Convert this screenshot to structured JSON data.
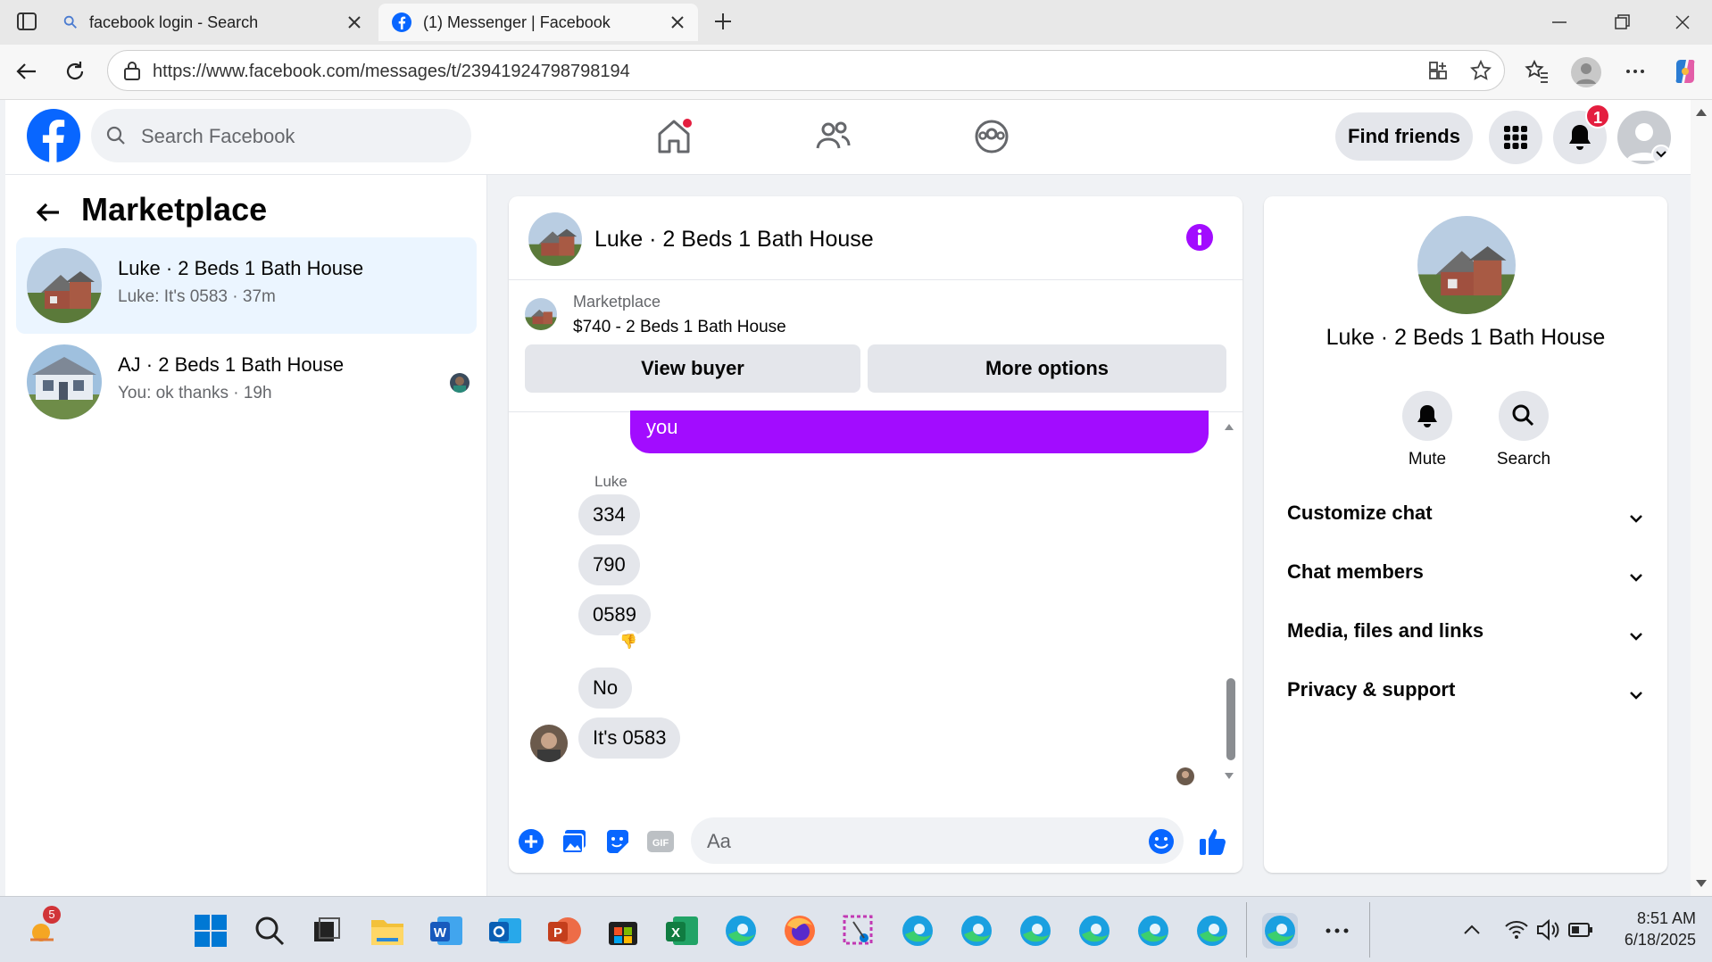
{
  "browser": {
    "tabs": [
      {
        "title": "facebook login - Search",
        "icon": "search-icon"
      },
      {
        "title": "(1) Messenger | Facebook",
        "icon": "facebook-icon"
      }
    ],
    "url": "https://www.facebook.com/messages/t/23941924798798194"
  },
  "header": {
    "search_placeholder": "Search Facebook",
    "find_friends": "Find friends",
    "notification_count": "1"
  },
  "sidebar": {
    "title": "Marketplace",
    "conversations": [
      {
        "name": "Luke · 2 Beds 1 Bath House",
        "preview": "Luke: It's 0583 · 37m",
        "active": true
      },
      {
        "name": "AJ · 2 Beds 1 Bath House",
        "preview": "You: ok thanks · 19h",
        "active": false
      }
    ]
  },
  "chat": {
    "title": "Luke · 2 Beds 1 Bath House",
    "marketplace_label": "Marketplace",
    "listing": "$740 - 2 Beds 1 Bath House",
    "view_buyer": "View buyer",
    "more_options": "More options",
    "outgoing_tail": "you",
    "sender": "Luke",
    "messages": [
      "334",
      "790",
      "0589",
      "No",
      "It's 0583"
    ],
    "reaction": "👎",
    "input_placeholder": "Aa"
  },
  "details": {
    "title": "Luke · 2 Beds 1 Bath House",
    "actions": [
      "Mute",
      "Search"
    ],
    "sections": [
      "Customize chat",
      "Chat members",
      "Media, files and links",
      "Privacy & support"
    ]
  },
  "taskbar": {
    "weather_badge": "5",
    "time": "8:51 AM",
    "date": "6/18/2025"
  },
  "colors": {
    "fb_blue": "#0866ff",
    "messenger_purple": "#a20cff",
    "badge_red": "#e41e3f"
  }
}
